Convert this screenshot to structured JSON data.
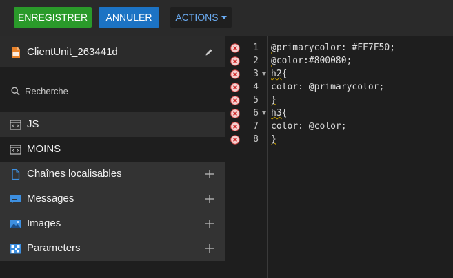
{
  "toolbar": {
    "save_label": "ENREGISTRER",
    "cancel_label": "ANNULER",
    "actions_label": "ACTIONS"
  },
  "sidebar": {
    "unit_name": "ClientUnit_263441d",
    "search_placeholder": "Recherche",
    "items": [
      {
        "label": "JS",
        "icon": "code-file-icon"
      },
      {
        "label": "MOINS",
        "icon": "code-file-icon"
      },
      {
        "label": "Chaînes localisables",
        "icon": "document-icon"
      },
      {
        "label": "Messages",
        "icon": "chat-icon"
      },
      {
        "label": "Images",
        "icon": "image-icon"
      },
      {
        "label": "Parameters",
        "icon": "qr-code-icon"
      }
    ]
  },
  "editor": {
    "lines": [
      {
        "num": "1",
        "a": "@",
        "b": "primarycolor: #FF7F50;"
      },
      {
        "num": "2",
        "a": "@",
        "b": "color:#800080;"
      },
      {
        "num": "3",
        "a": "h2",
        "b": "{"
      },
      {
        "num": "4",
        "a": "",
        "b": "color: @primarycolor;"
      },
      {
        "num": "5",
        "a": "}",
        "b": ""
      },
      {
        "num": "6",
        "a": "h3",
        "b": "{"
      },
      {
        "num": "7",
        "a": "",
        "b": "color: @color;"
      },
      {
        "num": "8",
        "a": "}",
        "b": ""
      }
    ]
  },
  "colors": {
    "save": "#2a9a2a",
    "cancel": "#1c73c4",
    "actions_text": "#6aaaf0",
    "error": "#e04040"
  }
}
